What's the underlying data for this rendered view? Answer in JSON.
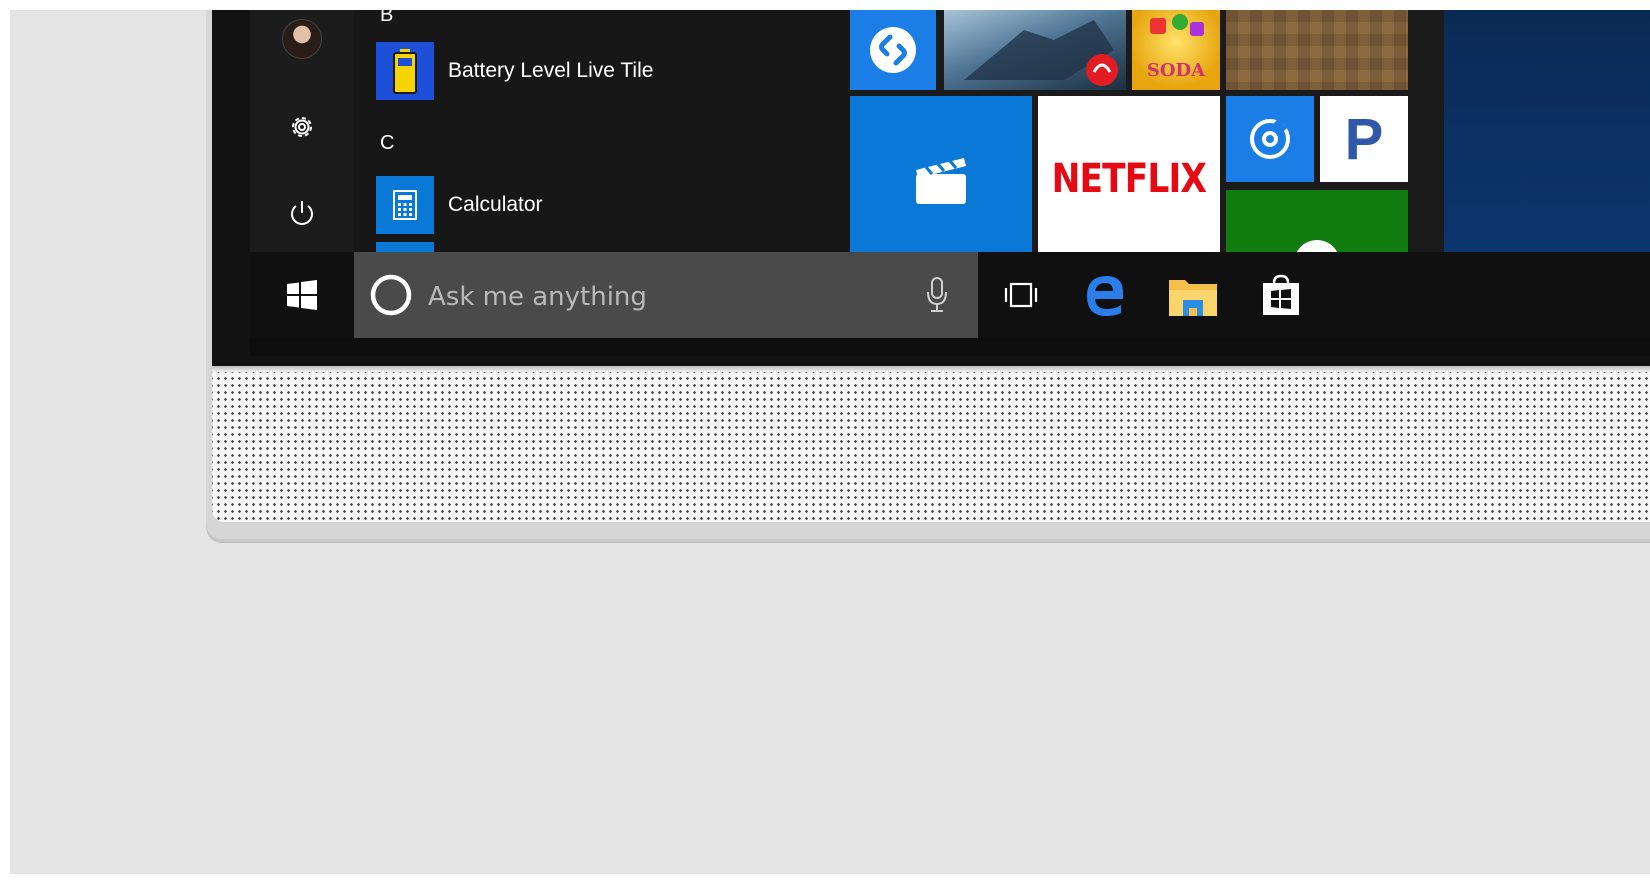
{
  "start_menu": {
    "rail": {
      "avatar_icon": "user-avatar-icon",
      "settings_icon": "gear-icon",
      "power_icon": "power-icon"
    },
    "sections": [
      {
        "letter": "B",
        "apps": [
          {
            "label": "Battery Level Live Tile",
            "icon": "battery-icon",
            "tile_color": "#1e4fd8"
          }
        ]
      },
      {
        "letter": "C",
        "apps": [
          {
            "label": "Calculator",
            "icon": "calculator-icon",
            "tile_color": "#0a78d7"
          }
        ]
      }
    ],
    "tiles": [
      {
        "name": "shazam",
        "icon": "shazam-icon",
        "color": "#1a7ee6"
      },
      {
        "name": "game",
        "icon": "snowboard-image-icon",
        "color": "#3b5f7f"
      },
      {
        "name": "candy",
        "icon": "candy-crush-icon",
        "color": "#f0c020",
        "text": "SODA"
      },
      {
        "name": "minecraft",
        "icon": "minecraft-icon",
        "color": "#8c6a42"
      },
      {
        "name": "movies",
        "icon": "clapperboard-icon",
        "color": "#0a78d7"
      },
      {
        "name": "netflix",
        "icon": "netflix-logo-icon",
        "color": "#ffffff",
        "text": "NETFLIX",
        "text_color": "#e50914"
      },
      {
        "name": "groove",
        "icon": "groove-music-icon",
        "color": "#1a7ee6"
      },
      {
        "name": "pandora",
        "icon": "pandora-icon",
        "color": "#ffffff",
        "text": "P",
        "text_color": "#2f59a8"
      },
      {
        "name": "xbox",
        "icon": "xbox-icon",
        "color": "#107c10"
      }
    ]
  },
  "taskbar": {
    "start_icon": "windows-logo-icon",
    "search": {
      "placeholder": "Ask me anything",
      "cortana_icon": "cortana-circle-icon",
      "mic_icon": "microphone-icon"
    },
    "apps": [
      {
        "name": "task-view",
        "icon": "task-view-icon"
      },
      {
        "name": "edge",
        "icon": "edge-browser-icon"
      },
      {
        "name": "file-explorer",
        "icon": "folder-icon"
      },
      {
        "name": "store",
        "icon": "store-bag-icon"
      }
    ]
  }
}
